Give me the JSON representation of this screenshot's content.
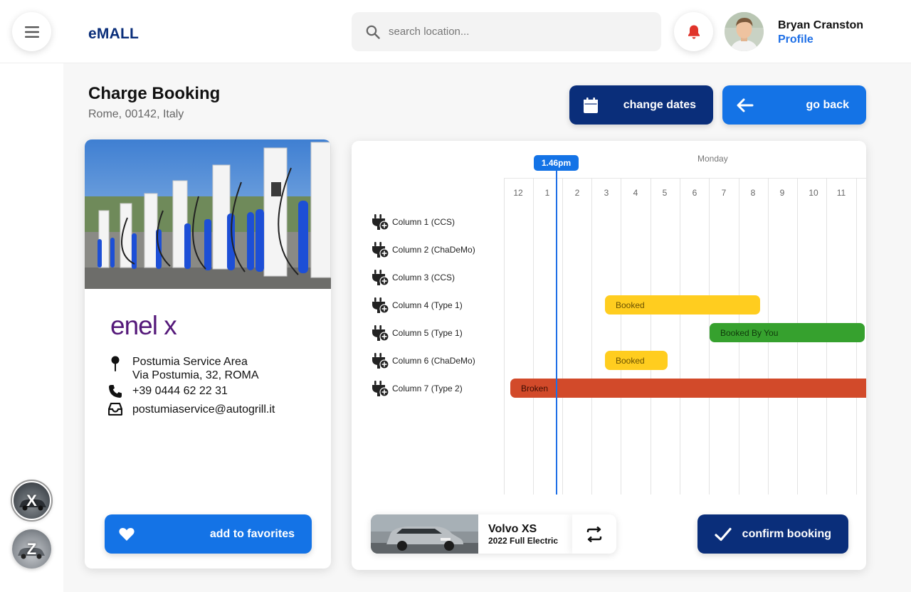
{
  "app": {
    "logo": "eMALL"
  },
  "search": {
    "placeholder": "search location..."
  },
  "user": {
    "name": "Bryan Cranston",
    "profile_link": "Profile"
  },
  "page": {
    "title": "Charge Booking",
    "subtitle": "Rome, 00142, Italy"
  },
  "actions": {
    "change_dates": "change dates",
    "go_back": "go back",
    "add_favorites": "add to favorites",
    "confirm_booking": "confirm booking"
  },
  "station": {
    "brand": "enel x",
    "address_line1": "Postumia Service Area",
    "address_line2": "Via Postumia, 32, ROMA",
    "phone": "+39 0444 62 22 31",
    "email": "postumiaservice@autogrill.it"
  },
  "schedule": {
    "day": "Monday",
    "current_time": "1.46pm",
    "hours": [
      "12",
      "1",
      "2",
      "3",
      "4",
      "5",
      "6",
      "7",
      "8",
      "9",
      "10",
      "11"
    ],
    "columns": [
      "Column 1 (CCS)",
      "Column 2 (ChaDeMo)",
      "Column 3 (CCS)",
      "Column 4 (Type 1)",
      "Column 5 (Type 1)",
      "Column 6 (ChaDeMo)",
      "Column 7 (Type 2)"
    ],
    "bookings": [
      {
        "column": 4,
        "label": "Booked",
        "color": "#ffcd1f"
      },
      {
        "column": 5,
        "label": "Booked By You",
        "color": "#36a12e"
      },
      {
        "column": 6,
        "label": "Booked",
        "color": "#ffcd1f"
      },
      {
        "column": 7,
        "label": "Broken",
        "color": "#d24a2a"
      }
    ]
  },
  "vehicle": {
    "name": "Volvo XS",
    "detail": "2022 Full Electric"
  },
  "garage": {
    "car_1": "X",
    "car_2": "Z"
  },
  "colors": {
    "navy": "#0a2e7a",
    "blue": "#1473e6",
    "booked": "#ffcd1f",
    "booked_by_you": "#36a12e",
    "broken": "#d24a2a"
  }
}
